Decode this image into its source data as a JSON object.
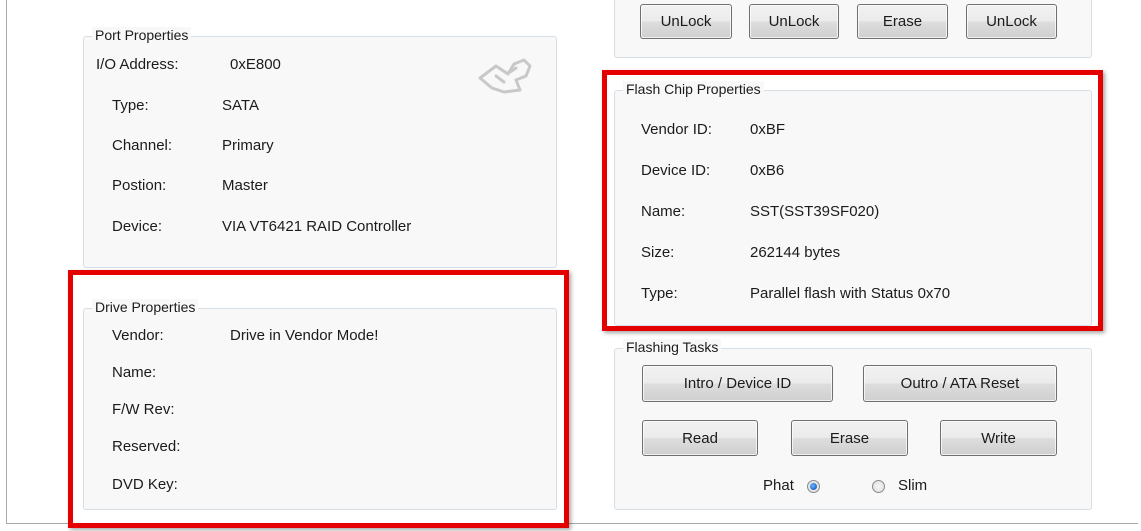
{
  "top_buttons": [
    "UnLock",
    "UnLock",
    "Erase",
    "UnLock"
  ],
  "port_properties": {
    "title": "Port Properties",
    "rows": [
      {
        "label": "I/O Address:",
        "value": "0xE800"
      },
      {
        "label": "Type:",
        "value": "SATA"
      },
      {
        "label": "Channel:",
        "value": "Primary"
      },
      {
        "label": "Postion:",
        "value": "Master"
      },
      {
        "label": "Device:",
        "value": "VIA VT6421 RAID Controller"
      }
    ],
    "icon": "sata-plug-icon"
  },
  "drive_properties": {
    "title": "Drive Properties",
    "rows": [
      {
        "label": "Vendor:",
        "value": "Drive in Vendor Mode!"
      },
      {
        "label": "Name:",
        "value": ""
      },
      {
        "label": "F/W Rev:",
        "value": ""
      },
      {
        "label": "Reserved:",
        "value": ""
      },
      {
        "label": "DVD Key:",
        "value": ""
      }
    ]
  },
  "flash_chip_properties": {
    "title": "Flash Chip Properties",
    "rows": [
      {
        "label": "Vendor ID:",
        "value": "0xBF"
      },
      {
        "label": "Device ID:",
        "value": "0xB6"
      },
      {
        "label": "Name:",
        "value": "SST(SST39SF020)"
      },
      {
        "label": "Size:",
        "value": "262144 bytes"
      },
      {
        "label": "Type:",
        "value": "Parallel flash with Status 0x70"
      }
    ]
  },
  "flashing_tasks": {
    "title": "Flashing Tasks",
    "intro_button": "Intro / Device ID",
    "outro_button": "Outro / ATA Reset",
    "read_button": "Read",
    "erase_button": "Erase",
    "write_button": "Write",
    "radio_options": [
      {
        "label": "Phat",
        "checked": true
      },
      {
        "label": "Slim",
        "checked": false
      }
    ]
  },
  "colors": {
    "highlight": "#e50000",
    "group_border": "#d5dfe5",
    "radio_selected": "#1f63c4"
  }
}
